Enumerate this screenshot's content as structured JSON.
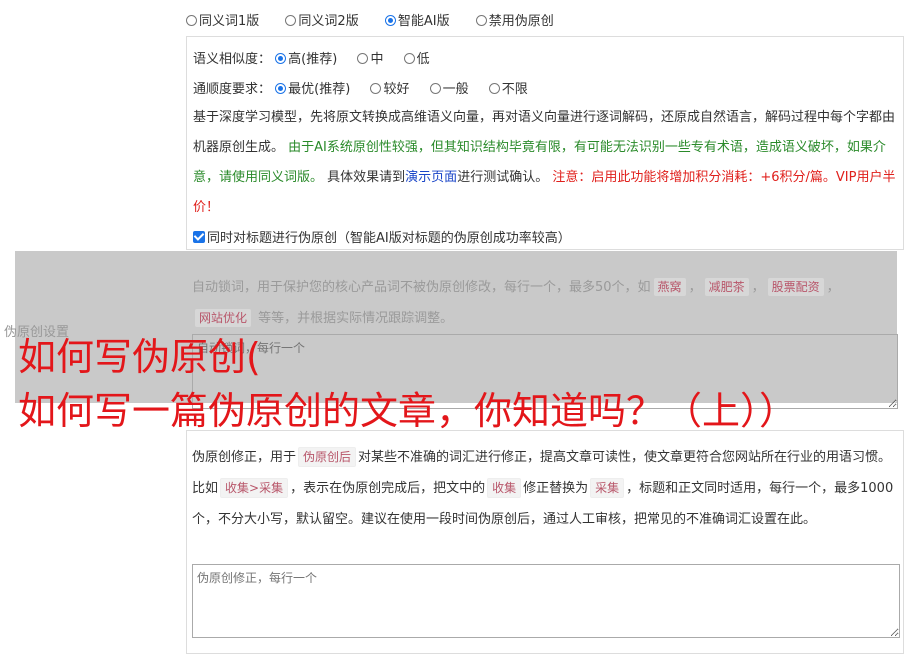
{
  "mode": {
    "options": [
      "同义词1版",
      "同义词2版",
      "智能AI版",
      "禁用伪原创"
    ],
    "selected": "智能AI版"
  },
  "similarity": {
    "label": "语义相似度：",
    "options": [
      "高(推荐)",
      "中",
      "低"
    ],
    "selected": "高(推荐)"
  },
  "fluency": {
    "label": "通顺度要求：",
    "options": [
      "最优(推荐)",
      "较好",
      "一般",
      "不限"
    ],
    "selected": "最优(推荐)"
  },
  "ai_desc": {
    "part1": "基于深度学习模型，先将原文转换成高维语义向量，再对语义向量进行逐词解码，还原成自然语言，解码过程中每个字都由机器原创生成。",
    "part2": "由于AI系统原创性较强，但其知识结构毕竟有限，有可能无法识别一些专有术语，造成语义破坏，如果介意，请使用同义词版。",
    "part3": "具体效果请到",
    "link": "演示页面",
    "part4": "进行测试确认。",
    "warning": "注意：启用此功能将增加积分消耗：+6积分/篇。VIP用户半价！"
  },
  "title_option": {
    "label": "同时对标题进行伪原创（智能AI版对标题的伪原创成功率较高）",
    "checked": true
  },
  "lock": {
    "desc_before": "自动锁词，用于保护您的核心产品词不被伪原创修改，每行一个，最多50个，如",
    "tags": [
      "燕窝",
      "减肥茶",
      "股票配资",
      "网站优化"
    ],
    "desc_after": "等等，并根据实际情况跟踪调整。",
    "placeholder": "自动锁词，每行一个"
  },
  "settings_label": "伪原创设置",
  "correction": {
    "desc1": "伪原创修正，用于",
    "tag1": "伪原创后",
    "desc2": "对某些不准确的词汇进行修正，提高文章可读性，使文章更符合您网站所在行业的用语习惯。比如",
    "tag2": "收集>采集",
    "desc3": "，表示在伪原创完成后，把文中的",
    "tag3": "收集",
    "desc4": "修正替换为",
    "tag4": "采集",
    "desc5": "，标题和正文同时适用，每行一个，最多1000个，不分大小写，默认留空。建议在使用一段时间伪原创后，通过人工审核，把常见的不准确词汇设置在此。",
    "placeholder": "伪原创修正，每行一个"
  },
  "headline": {
    "line1": "如何写伪原创(",
    "line2": "如何写一篇伪原创的文章，你知道吗？（上））"
  }
}
